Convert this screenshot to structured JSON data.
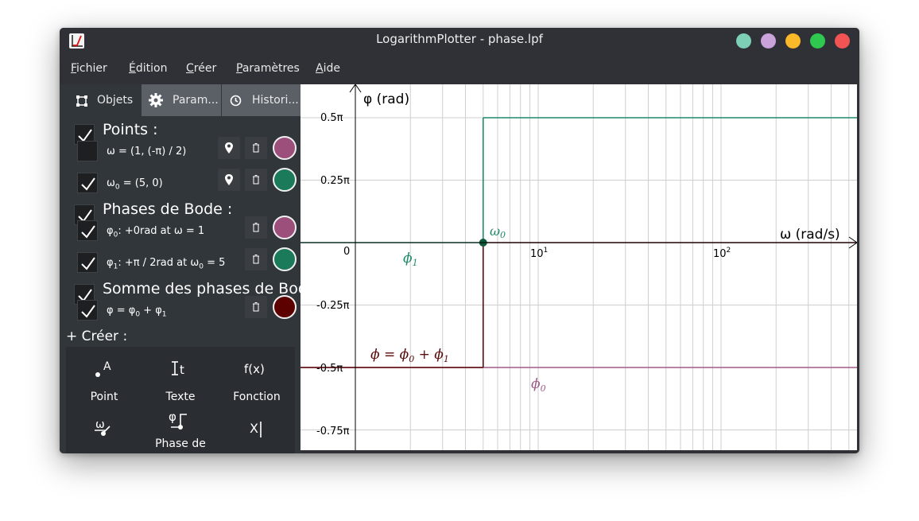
{
  "window": {
    "title": "LogarithmPlotter - phase.lpf",
    "buttons": [
      {
        "name": "window-btn-teal",
        "color": "#7dcfb6"
      },
      {
        "name": "window-btn-lavender",
        "color": "#c9a3d9"
      },
      {
        "name": "window-btn-minimize",
        "color": "#f9b928"
      },
      {
        "name": "window-btn-maximize",
        "color": "#2ec94e"
      },
      {
        "name": "window-btn-close",
        "color": "#f25454"
      }
    ]
  },
  "menu": {
    "fichier": {
      "first": "F",
      "rest": "ichier"
    },
    "edition": {
      "first": "É",
      "rest": "dition"
    },
    "creer": {
      "first": "C",
      "rest": "réer"
    },
    "parametres": {
      "first": "P",
      "rest": "aramètres"
    },
    "aide": {
      "first": "A",
      "rest": "ide"
    }
  },
  "tabs": {
    "objets": "Objets",
    "parametres": "Param...",
    "historique": "Histori..."
  },
  "objects": {
    "points_title": "Points :",
    "point1": "ω = (1, (-π) / 2)",
    "point2_pre": "ω",
    "point2_sub": "0",
    "point2_post": " = (5, 0)",
    "phases_title": "Phases de Bode :",
    "phase1_pre": "φ",
    "phase1_sub": "0",
    "phase1_post": ": +0rad at ω = 1",
    "phase2_pre": "φ",
    "phase2_sub": "1",
    "phase2_mid": ": +π / 2rad at ω",
    "phase2_sub2": "0",
    "phase2_post": " = 5",
    "somme_title": "Somme des phases de Bode",
    "somme_pre": "φ = φ",
    "somme_sub1": "0",
    "somme_mid": " + φ",
    "somme_sub2": "1"
  },
  "colors": {
    "pink": "#9b4f7a",
    "green": "#1b7a5a",
    "darkred": "#5c0000",
    "pink_line": "#a05a8a",
    "green_line": "#1f8a6a",
    "green_point_dark": "#0f5a3a",
    "darkred_line": "#5a0a0a"
  },
  "create": {
    "title": "+ Créer :",
    "point": "Point",
    "texte": "Texte",
    "fonction": "Fonction",
    "phase": "Phase de",
    "point_icon_letter": "A",
    "texte_icon": "t",
    "fonction_icon": "f(x)",
    "phase_icon": "φ",
    "omega_icon": "ω",
    "x_icon": "X"
  },
  "plot": {
    "y_axis_label": "φ (rad)",
    "x_axis_label": "ω (rad/s)",
    "y_ticks": [
      "0.5π",
      "0.25π",
      "0",
      "-0.25π",
      "-0.5π",
      "-0.75π"
    ],
    "x_ticks": {
      "base": "10",
      "exp1": "1",
      "exp2": "2"
    },
    "label_omega0": "ω",
    "label_omega0_sub": "0",
    "label_phi1": "ϕ",
    "label_phi1_sub": "1",
    "label_phi0": "ϕ",
    "label_phi0_sub": "0",
    "label_sum": "ϕ = ϕ",
    "label_sum_sub1": "0",
    "label_sum_mid": " + ϕ",
    "label_sum_sub2": "1"
  }
}
